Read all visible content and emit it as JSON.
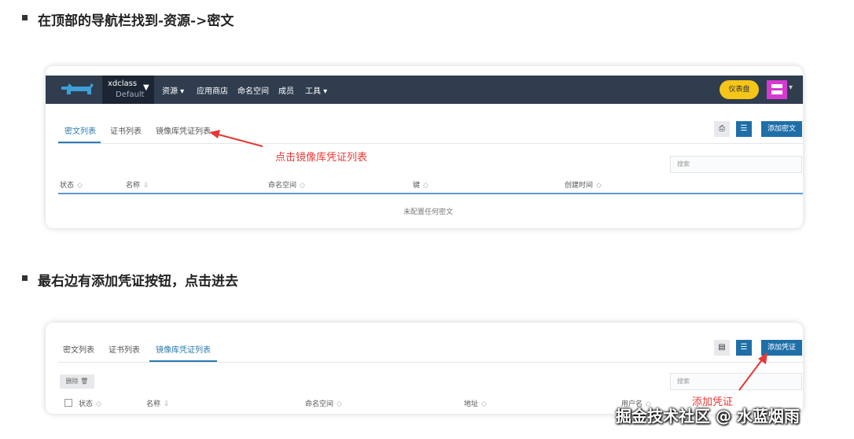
{
  "steps": [
    {
      "text": "在顶部的导航栏找到-资源->密文"
    },
    {
      "text": "最右边有添加凭证按钮，点击进去"
    }
  ],
  "screen1": {
    "cluster": {
      "name": "xdclass",
      "sub": "Default"
    },
    "nav": [
      "资源",
      "应用商店",
      "命名空间",
      "成员",
      "工具"
    ],
    "dashboard_label": "仪表盘",
    "tabs": [
      "密文列表",
      "证书列表",
      "镜像库凭证列表"
    ],
    "add_button": "添加密文",
    "search_placeholder": "搜索",
    "columns": [
      "状态",
      "名称",
      "命名空间",
      "键",
      "创建时间"
    ],
    "empty_text": "未配置任何密文"
  },
  "screen2": {
    "tabs": [
      "密文列表",
      "证书列表",
      "镜像库凭证列表"
    ],
    "add_button": "添加凭证",
    "search_placeholder": "搜索",
    "delete_button": "删除",
    "columns": [
      "状态",
      "名称",
      "命名空间",
      "地址",
      "用户名"
    ]
  },
  "annotations": {
    "first": "点击镜像库凭证列表",
    "second": "添加凭证"
  },
  "watermark": "掘金技术社区 @ 水蓝烟雨",
  "colors": {
    "header": "#2f3d4f",
    "accent": "#1e6fa8",
    "annotation": "#e53935",
    "dashboard": "#f5c518"
  }
}
